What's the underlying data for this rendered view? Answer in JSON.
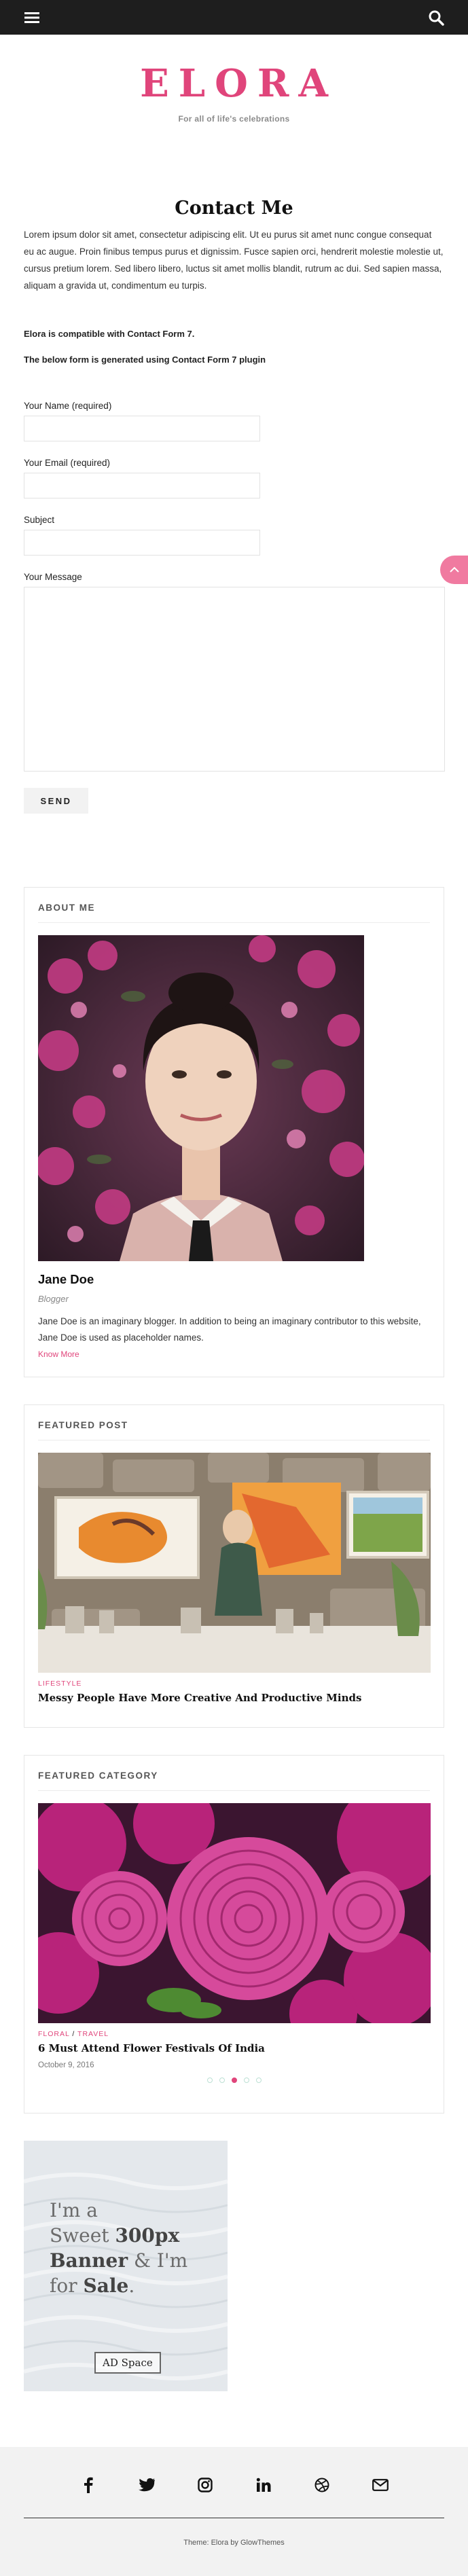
{
  "nav": {
    "menu_icon": "hamburger-menu-icon",
    "search_icon": "search-icon"
  },
  "site": {
    "logo": "ELORA",
    "tagline": "For all of life's celebrations"
  },
  "page": {
    "title": "Contact Me",
    "intro": "Lorem ipsum dolor sit amet, consectetur adipiscing elit. Ut eu purus sit amet nunc congue consequat eu ac augue. Proin finibus tempus purus et dignissim. Fusce sapien orci, hendrerit molestie molestie ut, cursus pretium lorem. Sed libero libero, luctus sit amet mollis blandit, rutrum ac dui. Sed sapien massa, aliquam a gravida ut, condimentum eu turpis.",
    "compat_line_1": "Elora is compatible with Contact Form 7.",
    "compat_line_2": "The below form is generated using Contact Form 7 plugin"
  },
  "form": {
    "name_label": "Your Name (required)",
    "email_label": "Your Email (required)",
    "subject_label": "Subject",
    "message_label": "Your Message",
    "send_label": "SEND"
  },
  "about": {
    "heading": "ABOUT ME",
    "name": "Jane Doe",
    "role": "Blogger",
    "bio": "Jane Doe is an imaginary blogger. In addition to being an imaginary contributor to this website, Jane Doe is used as placeholder names.",
    "link": "Know More"
  },
  "featured_post": {
    "heading": "FEATURED POST",
    "category": "LIFESTYLE",
    "title": "Messy People Have More Creative And Productive Minds"
  },
  "featured_category": {
    "heading": "FEATURED CATEGORY",
    "category_1": "FLORAL",
    "separator": "/",
    "category_2": "TRAVEL",
    "title": "6 Must Attend Flower Festivals Of India",
    "date": "October 9, 2016",
    "active_slide": 3,
    "slide_count": 5
  },
  "ad": {
    "line1": "I'm a",
    "line2a": "Sweet ",
    "line2b": "300px",
    "line3a": "Banner",
    "line3b": " & I'm",
    "line4a": "for ",
    "line4b": "Sale",
    "line4c": ".",
    "label": "AD Space"
  },
  "footer": {
    "social_icons": [
      "facebook-icon",
      "twitter-icon",
      "instagram-icon",
      "linkedin-icon",
      "dribbble-icon",
      "email-icon"
    ],
    "credit": "Theme: Elora by GlowThemes"
  },
  "colors": {
    "accent": "#e0457b",
    "topbar": "#1e1e1e",
    "scroll_button": "#f07aa0"
  }
}
